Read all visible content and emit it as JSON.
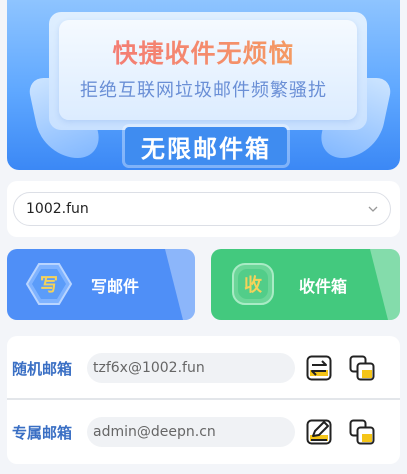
{
  "banner": {
    "headline": "快捷收件无烦恼",
    "subline": "拒绝互联网垃圾邮件频繁骚扰",
    "badge": "无限邮件箱"
  },
  "domain_select": {
    "value": "1002.fun"
  },
  "actions": {
    "compose": {
      "label": "写邮件",
      "icon_char": "写"
    },
    "inbox": {
      "label": "收件箱",
      "icon_char": "收"
    }
  },
  "mailboxes": [
    {
      "label": "随机邮箱",
      "address": "tzf6x@1002.fun",
      "action_icon": "refresh-icon",
      "copy_icon": "copy-icon"
    },
    {
      "label": "专属邮箱",
      "address": "admin@deepn.cn",
      "action_icon": "edit-icon",
      "copy_icon": "copy-icon"
    }
  ],
  "colors": {
    "banner_blue": "#5ea7ff",
    "compose_blue": "#4f8ff7",
    "inbox_green": "#43c97e",
    "label_blue": "#3a6fc4",
    "icon_yellow": "#f5c518"
  }
}
